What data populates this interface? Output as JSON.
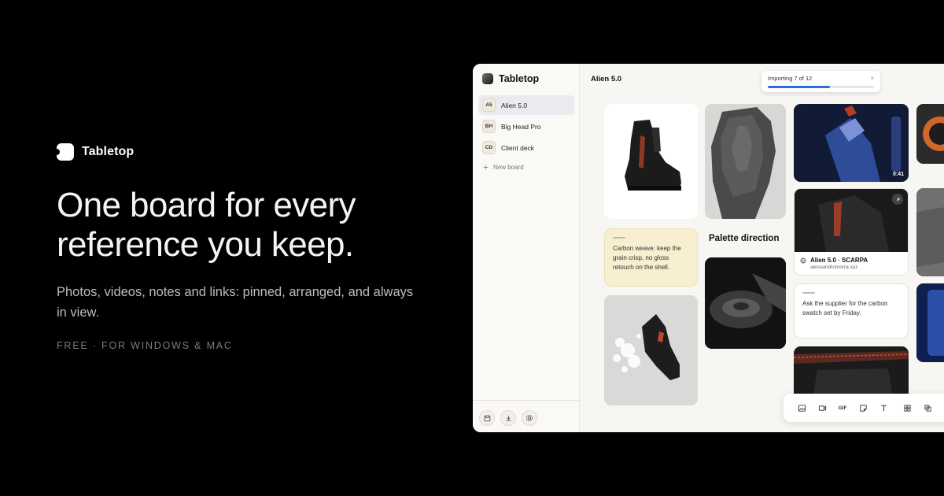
{
  "hero": {
    "brand": "Tabletop",
    "headline": "One board for every reference you keep.",
    "subtitle": "Photos, videos, notes and links: pinned, arranged, and always in view.",
    "tagline": "FREE · FOR WINDOWS & MAC"
  },
  "app": {
    "brand": "Tabletop",
    "boards": [
      {
        "badge": "A5",
        "name": "Alien 5.0",
        "active": true
      },
      {
        "badge": "BH",
        "name": "Big Head Pro",
        "active": false
      },
      {
        "badge": "CD",
        "name": "Client deck",
        "active": false
      }
    ],
    "new_board_label": "New board",
    "board_title": "Alien 5.0",
    "toast": {
      "text": "Importing 7 of 12",
      "progress": 0.583,
      "close": "×"
    },
    "notes": {
      "carbon": "Carbon weave: keep the grain crisp, no gloss retouch on the shell.",
      "supplier": "Ask the supplier for the carbon swatch set by Friday."
    },
    "palette_heading": "Palette direction",
    "link_card": {
      "title": "Alien 5.0 · SCARPA",
      "url": "alessandromorra.xyz"
    },
    "video_duration": "0:41",
    "toolbar_gif": "GIF",
    "accent": "#2e6fd6"
  }
}
